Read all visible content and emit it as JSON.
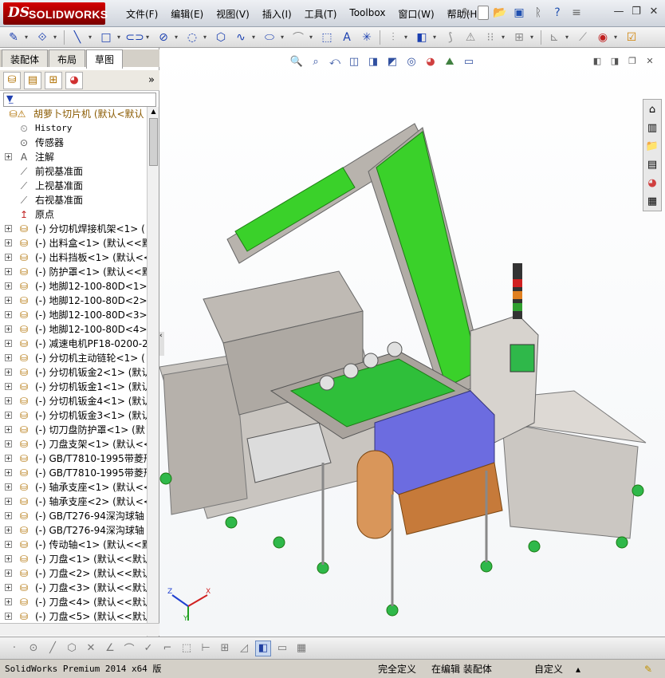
{
  "app": {
    "logo_ds": "DS",
    "logo_name": "SOLIDWORKS"
  },
  "menu": [
    "文件(F)",
    "编辑(E)",
    "视图(V)",
    "插入(I)",
    "工具(T)",
    "Toolbox",
    "窗口(W)",
    "帮助(H)"
  ],
  "quick_access_icons": [
    "pin-icon",
    "new-document-icon",
    "open-icon",
    "save-icon",
    "print-icon",
    "help-icon",
    "options-icon"
  ],
  "window_controls": [
    "minimize",
    "restore",
    "close"
  ],
  "command_toolbar_icons": [
    "smart-dimension-icon",
    "relations-icon",
    "line-icon",
    "rectangle-icon",
    "slot-icon",
    "circle-icon",
    "arc-icon",
    "polygon-icon",
    "spline-icon",
    "ellipse-icon",
    "fillet-icon",
    "offset-icon",
    "text-icon",
    "point-icon",
    "mirror-icon",
    "convert-icon",
    "trim-icon",
    "pattern-icon",
    "move-icon",
    "display-relations-icon",
    "repair-icon",
    "quick-snap-icon",
    "rapid-sketch-icon"
  ],
  "panel_tabs": [
    {
      "label": "装配体",
      "active": false
    },
    {
      "label": "布局",
      "active": false
    },
    {
      "label": "草图",
      "active": true
    }
  ],
  "feature_manager_icons": [
    "feature-tree-icon",
    "property-manager-icon",
    "configuration-manager-icon",
    "display-manager-icon"
  ],
  "feature_tree": {
    "root_label": "胡萝卜切片机  (默认<默认",
    "items": [
      {
        "label": "History",
        "icon": "history-icon",
        "expandable": false,
        "mono": true
      },
      {
        "label": "传感器",
        "icon": "sensor-icon",
        "expandable": false
      },
      {
        "label": "注解",
        "icon": "annotation-icon",
        "expandable": true
      },
      {
        "label": "前视基准面",
        "icon": "plane-icon",
        "expandable": false
      },
      {
        "label": "上视基准面",
        "icon": "plane-icon",
        "expandable": false
      },
      {
        "label": "右视基准面",
        "icon": "plane-icon",
        "expandable": false
      },
      {
        "label": "原点",
        "icon": "origin-icon",
        "expandable": false
      },
      {
        "label": "(-) 分切机焊接机架<1> (",
        "icon": "part-icon",
        "expandable": true
      },
      {
        "label": "(-) 出料盒<1> (默认<<默",
        "icon": "part-icon",
        "expandable": true
      },
      {
        "label": "(-) 出料挡板<1> (默认<<",
        "icon": "part-icon",
        "expandable": true
      },
      {
        "label": "(-) 防护罩<1> (默认<<默",
        "icon": "part-icon",
        "expandable": true
      },
      {
        "label": "(-) 地脚12-100-80D<1> (",
        "icon": "part-icon",
        "expandable": true
      },
      {
        "label": "(-) 地脚12-100-80D<2> (",
        "icon": "part-icon",
        "expandable": true
      },
      {
        "label": "(-) 地脚12-100-80D<3> (",
        "icon": "part-icon",
        "expandable": true
      },
      {
        "label": "(-) 地脚12-100-80D<4> (",
        "icon": "part-icon",
        "expandable": true
      },
      {
        "label": "(-) 减速电机PF18-0200-2",
        "icon": "part-icon",
        "expandable": true
      },
      {
        "label": "(-) 分切机主动链轮<1> (",
        "icon": "part-icon",
        "expandable": true
      },
      {
        "label": "(-) 分切机钣金2<1> (默认",
        "icon": "part-icon",
        "expandable": true
      },
      {
        "label": "(-) 分切机钣金1<1> (默认",
        "icon": "part-icon",
        "expandable": true
      },
      {
        "label": "(-) 分切机钣金4<1> (默认",
        "icon": "part-icon",
        "expandable": true
      },
      {
        "label": "(-) 分切机钣金3<1> (默认",
        "icon": "part-icon",
        "expandable": true
      },
      {
        "label": "(-) 切刀盘防护罩<1> (默",
        "icon": "part-icon",
        "expandable": true
      },
      {
        "label": "(-) 刀盘支架<1> (默认<<",
        "icon": "part-icon",
        "expandable": true
      },
      {
        "label": "(-) GB/T7810-1995带菱形",
        "icon": "part-icon",
        "expandable": true
      },
      {
        "label": "(-) GB/T7810-1995带菱形",
        "icon": "part-icon",
        "expandable": true
      },
      {
        "label": "(-) 轴承支座<1> (默认<<",
        "icon": "part-icon",
        "expandable": true
      },
      {
        "label": "(-) 轴承支座<2> (默认<<",
        "icon": "part-icon",
        "expandable": true
      },
      {
        "label": "(-) GB/T276-94深沟球轴",
        "icon": "part-icon",
        "expandable": true
      },
      {
        "label": "(-) GB/T276-94深沟球轴",
        "icon": "part-icon",
        "expandable": true
      },
      {
        "label": "(-) 传动轴<1> (默认<<默",
        "icon": "part-icon",
        "expandable": true
      },
      {
        "label": "(-) 刀盘<1> (默认<<默认",
        "icon": "part-icon",
        "expandable": true
      },
      {
        "label": "(-) 刀盘<2> (默认<<默认",
        "icon": "part-icon",
        "expandable": true
      },
      {
        "label": "(-) 刀盘<3> (默认<<默认",
        "icon": "part-icon",
        "expandable": true
      },
      {
        "label": "(-) 刀盘<4> (默认<<默认",
        "icon": "part-icon",
        "expandable": true
      },
      {
        "label": "(-) 刀盘<5> (默认<<默认",
        "icon": "part-icon",
        "expandable": true
      }
    ]
  },
  "heads_up_toolbar_icons": [
    "zoom-to-fit-icon",
    "zoom-area-icon",
    "previous-view-icon",
    "section-view-icon",
    "view-orientation-icon",
    "display-style-icon",
    "hide-show-icon",
    "edit-appearance-icon",
    "apply-scene-icon",
    "view-settings-icon"
  ],
  "task_pane_icons": [
    "home-icon",
    "design-library-icon",
    "file-explorer-icon",
    "view-palette-icon",
    "appearances-icon",
    "custom-properties-icon"
  ],
  "triad": {
    "x": "X",
    "y": "Y",
    "z": "Z"
  },
  "sketch_bar_icons": [
    "point-icon",
    "circle-icon",
    "line-icon",
    "polygon-icon",
    "trim-icon",
    "angle-icon",
    "arc-icon",
    "check-icon",
    "corner-icon",
    "rectangle-icon",
    "dimension-icon",
    "grid-icon",
    "angle-icon",
    "view-cube-icon",
    "section-icon",
    "table-icon"
  ],
  "status": {
    "product": "SolidWorks Premium 2014 x64 版",
    "definition": "完全定义",
    "mode": "在编辑 装配体",
    "units": "自定义"
  },
  "colors": {
    "brand": "#c8102e",
    "conveyor_green": "#3ad12a",
    "cover_blue": "#6c6ce0",
    "frame_gray": "#c9c5c0",
    "foot_green": "#2fb84a"
  }
}
